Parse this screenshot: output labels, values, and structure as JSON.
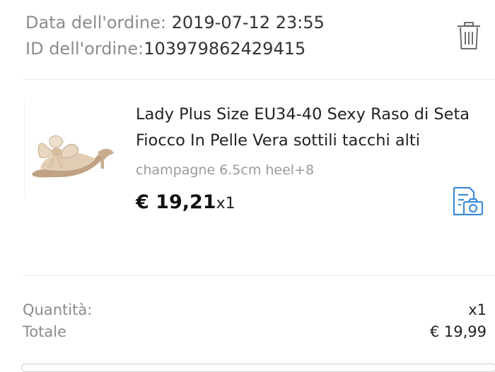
{
  "order": {
    "date_label": "Data dell'ordine:",
    "date_value": "2019-07-12 23:55",
    "id_label": "ID dell'ordine:",
    "id_value": "103979862429415"
  },
  "product": {
    "title": "Lady Plus Size EU34-40 Sexy Raso di Seta Fiocco In Pelle Vera sottili tacchi alti",
    "variant": "champagne 6.5cm heel+8",
    "price": "€ 19,21",
    "quantity": "x1"
  },
  "summary": {
    "quantity_label": "Quantità:",
    "quantity_value": "x1",
    "total_label": "Totale",
    "total_value": "€ 19,99"
  },
  "icons": {
    "delete": "trash-icon",
    "snapshot": "order-snapshot-icon",
    "thumbnail": "bow-sandal-image"
  },
  "colors": {
    "accent_blue": "#3d8bd8",
    "label_gray": "#8c8c8c",
    "variant_gray": "#9a9a9a",
    "shoe_champagne": "#d9c2a8"
  }
}
